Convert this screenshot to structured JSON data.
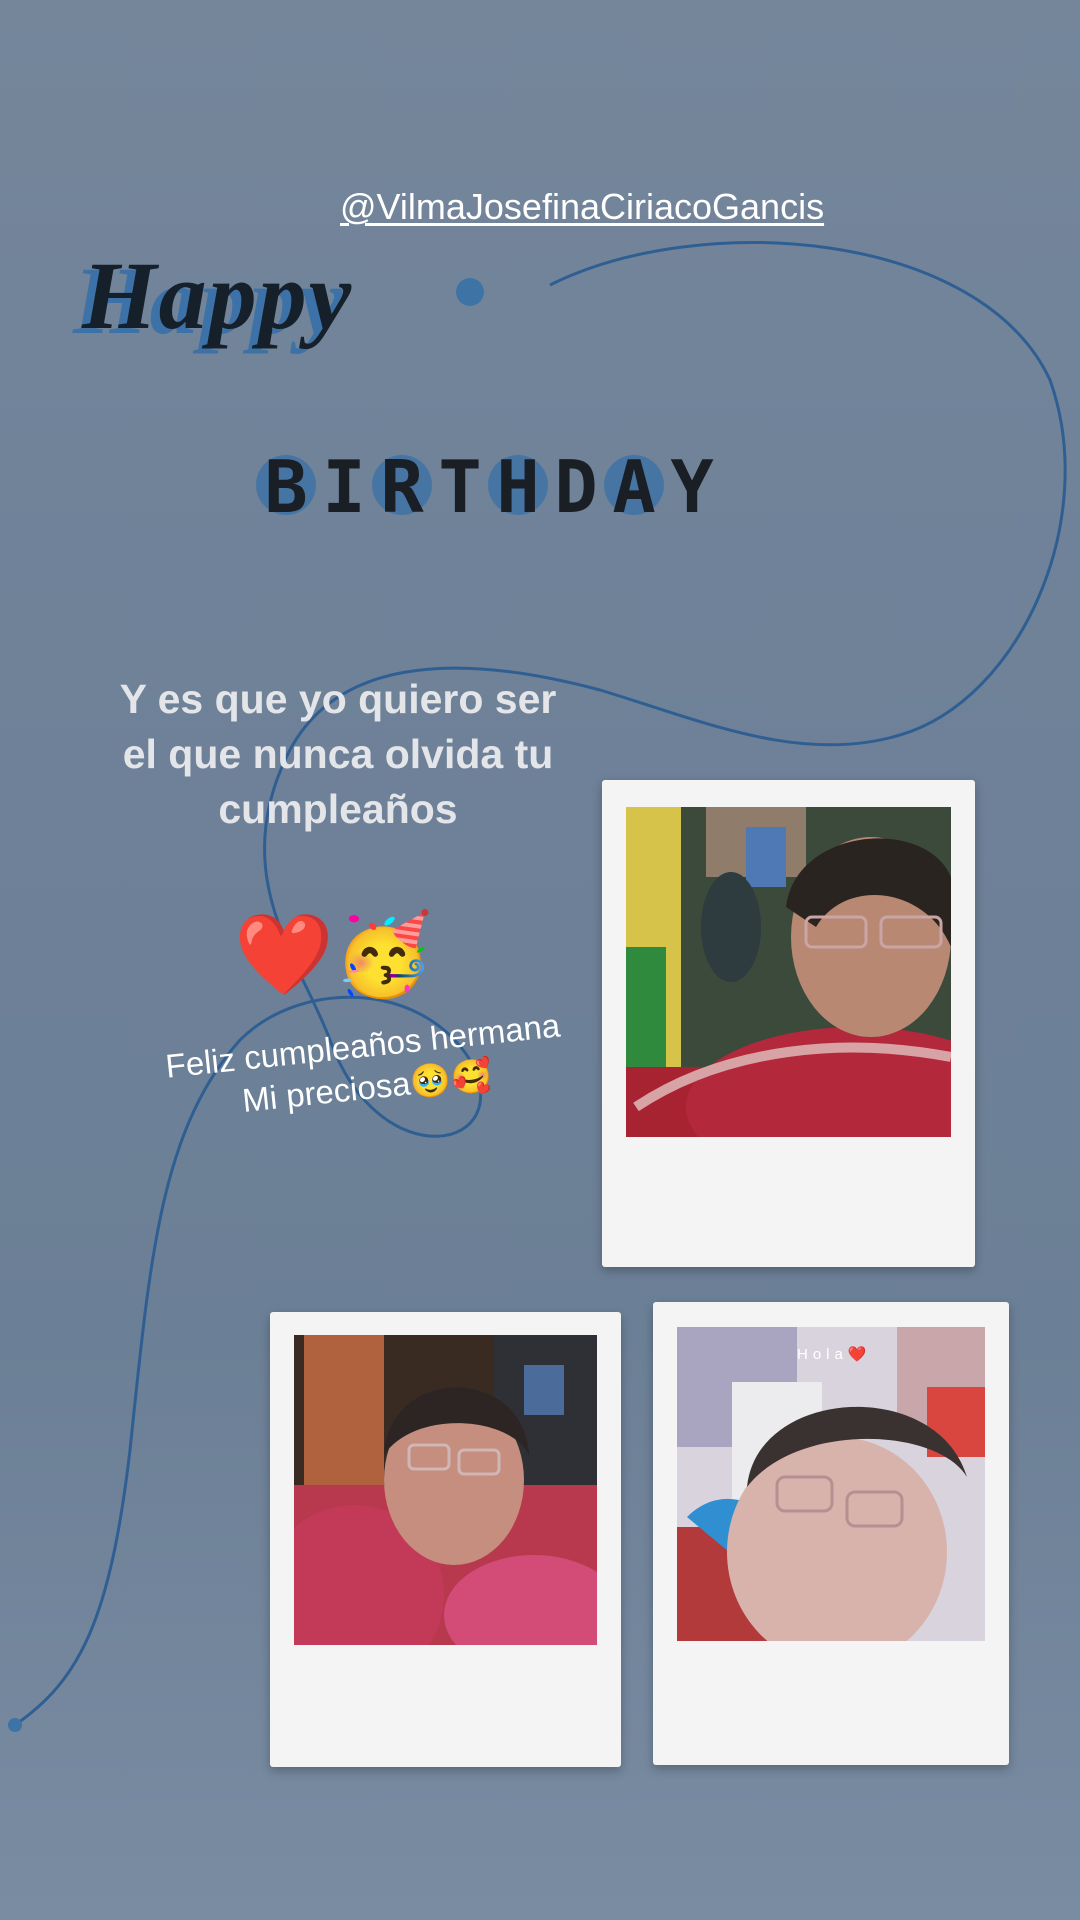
{
  "story": {
    "mention": "@VilmaJosefinaCiriacoGancis",
    "happy": "Happy",
    "birthday_letters": [
      "B",
      "I",
      "R",
      "T",
      "H",
      "D",
      "A",
      "Y"
    ],
    "quote_lines": [
      "Y es que yo quiero ser",
      "el que nunca olvida tu",
      "cumpleaños"
    ],
    "emoji_stickers": "❤️🥳",
    "caption_lines": [
      "Feliz cumpleaños hermana",
      "Mi preciosa🥹🥰"
    ],
    "photo3_overlay": "Hola❤️"
  },
  "colors": {
    "background": "#71849a",
    "accent_blue": "#3e73a6",
    "text_dark": "#15202b"
  }
}
